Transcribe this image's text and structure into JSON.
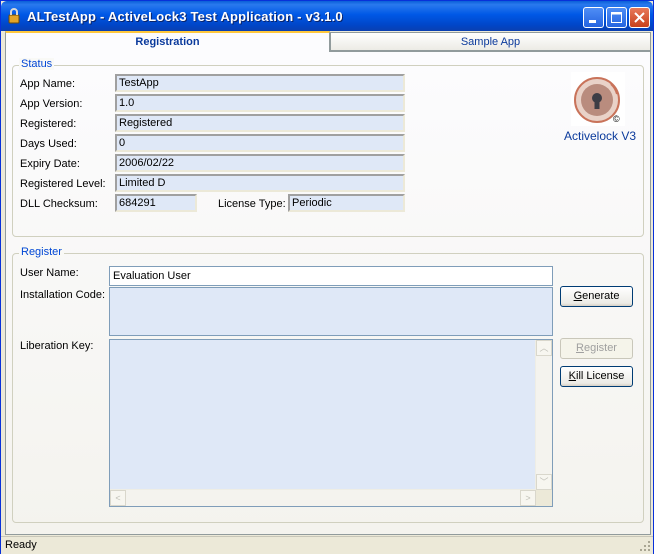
{
  "window": {
    "title": "ALTestApp - ActiveLock3 Test Application - v3.1.0",
    "controls": [
      "minimize-icon",
      "maximize-icon",
      "close-icon"
    ]
  },
  "tabs": [
    {
      "label": "Registration",
      "active": true
    },
    {
      "label": "Sample App",
      "active": false
    }
  ],
  "status_group": {
    "legend": "Status",
    "fields": {
      "app_name": {
        "label": "App Name:",
        "value": "TestApp"
      },
      "app_version": {
        "label": "App Version:",
        "value": "1.0"
      },
      "registered": {
        "label": "Registered:",
        "value": "Registered"
      },
      "days_used": {
        "label": "Days Used:",
        "value": "0"
      },
      "expiry_date": {
        "label": "Expiry Date:",
        "value": "2006/02/22"
      },
      "registered_level": {
        "label": "Registered Level:",
        "value": "Limited D"
      },
      "dll_checksum": {
        "label": "DLL Checksum:",
        "value": "684291"
      },
      "license_type": {
        "label": "License Type:",
        "value": "Periodic"
      }
    },
    "logo": {
      "caption": "Activelock V3",
      "icon": "activelock-logo-icon"
    }
  },
  "register_group": {
    "legend": "Register",
    "user_name": {
      "label": "User Name:",
      "value": "Evaluation User"
    },
    "installation_code": {
      "label": "Installation Code:",
      "value": ""
    },
    "liberation_key": {
      "label": "Liberation Key:",
      "value": ""
    },
    "buttons": {
      "generate": {
        "pre": "",
        "key": "G",
        "post": "enerate",
        "enabled": true
      },
      "register": {
        "pre": "",
        "key": "R",
        "post": "egister",
        "enabled": false
      },
      "kill_license": {
        "pre": "",
        "key": "K",
        "post": "ill License",
        "enabled": true
      }
    }
  },
  "statusbar": {
    "text": "Ready"
  },
  "colors": {
    "accent": "#0046d5",
    "titlebar": "#0058e6",
    "readonly_field": "#dfe8f7",
    "tab_highlight": "#ffc83c"
  }
}
